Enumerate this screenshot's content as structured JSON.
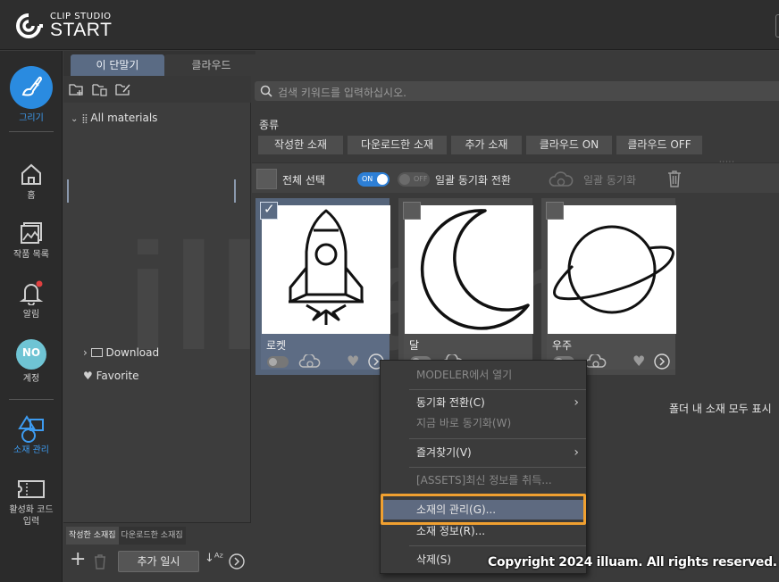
{
  "app": {
    "logo_small": "CLIP STUDIO",
    "logo_big": "START"
  },
  "nav": {
    "draw": "그리기",
    "home": "홈",
    "works": "작품 목록",
    "notifications": "알림",
    "account": "계정",
    "account_avatar": "NO",
    "materials": "소재 관리",
    "activation": "활성화 코드 입력"
  },
  "tabs": [
    {
      "label": "이 단말기",
      "active": true
    },
    {
      "label": "클라우드",
      "active": false
    }
  ],
  "folder_tree": {
    "all_materials": "All materials",
    "download": "Download",
    "favorite": "Favorite"
  },
  "material_sets": {
    "tabs": [
      "작성한 소재집",
      "다운로드한 소재집"
    ],
    "add_temp_button": "추가 일시"
  },
  "search": {
    "placeholder": "검색 키워드를 입력하십시오."
  },
  "filters": {
    "kind_label": "종류",
    "buttons": [
      "작성한 소재",
      "다운로드한 소재",
      "추가 소재",
      "클라우드 ON",
      "클라우드 OFF"
    ]
  },
  "select_bar": {
    "select_all": "전체 선택",
    "toggle_on": "ON",
    "toggle_off": "OFF",
    "bulk_switch": "일괄 동기화 전환",
    "bulk_sync": "일괄 동기화"
  },
  "materials": [
    {
      "name": "로켓",
      "selected": true,
      "icon": "rocket"
    },
    {
      "name": "달",
      "selected": false,
      "icon": "moon"
    },
    {
      "name": "우주",
      "selected": false,
      "icon": "planet"
    }
  ],
  "show_all_text": "폴더 내 소재 모두 표시",
  "context_menu": {
    "open_modeler": "MODELER에서 열기",
    "sync_switch": "동기화 전환(C)",
    "sync_now": "지금 바로 동기화(W)",
    "favorites": "즐겨찾기(V)",
    "assets_info": "[ASSETS]최신 정보를 취득...",
    "manage": "소재의 관리(G)...",
    "info": "소재 정보(R)...",
    "delete": "삭제(S)"
  },
  "watermark": "illuam",
  "copyright": "Copyright 2024 illuam. All rights reserved.",
  "colors": {
    "accent": "#2d7fd6",
    "highlight": "#f0a030",
    "selected_card": "#55647a",
    "notification_dot": "#e04040"
  }
}
